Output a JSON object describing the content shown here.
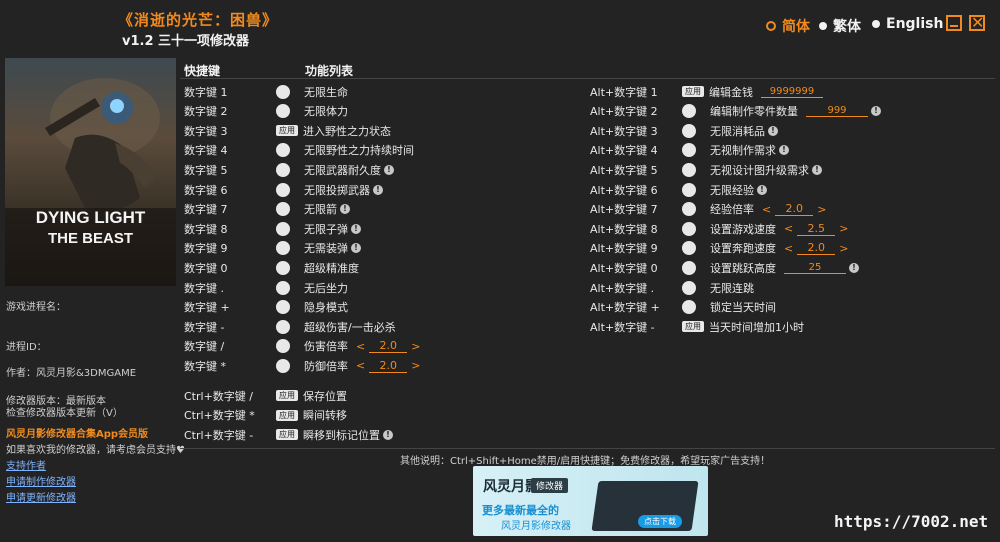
{
  "header": {
    "title": "《消逝的光芒：困兽》",
    "subtitle": "v1.2 三十一项修改器"
  },
  "languages": [
    {
      "label": "简体",
      "selected": true
    },
    {
      "label": "繁体",
      "selected": false
    },
    {
      "label": "English",
      "selected": false
    }
  ],
  "window_buttons": {
    "minimize_icon": "minimize-icon",
    "close_icon": "close-icon",
    "close_glyph": "✕"
  },
  "cover": {
    "line1": "DYING LIGHT",
    "line2": "THE BEAST"
  },
  "left_panel": {
    "process_name": "游戏进程名：",
    "process_id": "进程ID：",
    "author": "作者：风灵月影&3DMGAME",
    "version": "修改器版本：最新版本",
    "check_update": "检查修改器版本更新（V）",
    "promo": "风灵月影修改器合集App会员版",
    "support": "如果喜欢我的修改器，请考虑会员支持♥",
    "links": [
      "支持作者",
      "申请制作修改器",
      "申请更新修改器"
    ]
  },
  "columns": {
    "hotkey": "快捷键",
    "function_list": "功能列表"
  },
  "left_rows": [
    {
      "key": "数字键 1",
      "ctrl": "toggle",
      "label": "无限生命"
    },
    {
      "key": "数字键 2",
      "ctrl": "toggle",
      "label": "无限体力"
    },
    {
      "key": "数字键 3",
      "ctrl": "apply",
      "label": "进入野性之力状态"
    },
    {
      "key": "数字键 4",
      "ctrl": "toggle",
      "label": "无限野性之力持续时间"
    },
    {
      "key": "数字键 5",
      "ctrl": "toggle",
      "label": "无限武器耐久度",
      "info": true
    },
    {
      "key": "数字键 6",
      "ctrl": "toggle",
      "label": "无限投掷武器",
      "info": true
    },
    {
      "key": "数字键 7",
      "ctrl": "toggle",
      "label": "无限箭",
      "info": true
    },
    {
      "key": "数字键 8",
      "ctrl": "toggle",
      "label": "无限子弹",
      "info": true
    },
    {
      "key": "数字键 9",
      "ctrl": "toggle",
      "label": "无需装弹",
      "info": true
    },
    {
      "key": "数字键 0",
      "ctrl": "toggle",
      "label": "超级精准度"
    },
    {
      "key": "数字键 .",
      "ctrl": "toggle",
      "label": "无后坐力"
    },
    {
      "key": "数字键 +",
      "ctrl": "toggle",
      "label": "隐身模式"
    },
    {
      "key": "数字键 -",
      "ctrl": "toggle",
      "label": "超级伤害/一击必杀"
    },
    {
      "key": "数字键 /",
      "ctrl": "toggle",
      "label": "伤害倍率",
      "spin": "2.0"
    },
    {
      "key": "数字键 *",
      "ctrl": "toggle",
      "label": "防御倍率",
      "spin": "2.0"
    }
  ],
  "ctrl_rows": [
    {
      "key": "Ctrl+数字键 /",
      "ctrl": "apply",
      "label": "保存位置"
    },
    {
      "key": "Ctrl+数字键 *",
      "ctrl": "apply",
      "label": "瞬间转移"
    },
    {
      "key": "Ctrl+数字键 -",
      "ctrl": "apply",
      "label": "瞬移到标记位置",
      "info": true
    }
  ],
  "right_rows": [
    {
      "key": "Alt+数字键 1",
      "ctrl": "apply",
      "label": "编辑金钱",
      "field": "9999999"
    },
    {
      "key": "Alt+数字键 2",
      "ctrl": "toggle",
      "label": "编辑制作零件数量",
      "field": "999",
      "info": true
    },
    {
      "key": "Alt+数字键 3",
      "ctrl": "toggle",
      "label": "无限消耗品",
      "info": true
    },
    {
      "key": "Alt+数字键 4",
      "ctrl": "toggle",
      "label": "无视制作需求",
      "info": true
    },
    {
      "key": "Alt+数字键 5",
      "ctrl": "toggle",
      "label": "无视设计图升级需求",
      "info": true
    },
    {
      "key": "Alt+数字键 6",
      "ctrl": "toggle",
      "label": "无限经验",
      "info": true
    },
    {
      "key": "Alt+数字键 7",
      "ctrl": "toggle",
      "label": "经验倍率",
      "spin": "2.0"
    },
    {
      "key": "Alt+数字键 8",
      "ctrl": "toggle",
      "label": "设置游戏速度",
      "spin": "2.5"
    },
    {
      "key": "Alt+数字键 9",
      "ctrl": "toggle",
      "label": "设置奔跑速度",
      "spin": "2.0"
    },
    {
      "key": "Alt+数字键 0",
      "ctrl": "toggle",
      "label": "设置跳跃高度",
      "field": "25",
      "info": true
    },
    {
      "key": "Alt+数字键 .",
      "ctrl": "toggle",
      "label": "无限连跳"
    },
    {
      "key": "Alt+数字键 +",
      "ctrl": "toggle",
      "label": "锁定当天时间"
    },
    {
      "key": "Alt+数字键 -",
      "ctrl": "apply",
      "label": "当天时间增加1小时"
    }
  ],
  "apply_label": "应用",
  "info_glyph": "!",
  "spin_left": "<",
  "spin_right": ">",
  "footer_note": "其他说明：Ctrl+Shift+Home禁用/启用快捷键；免费修改器，希望玩家广告支持！",
  "ad": {
    "logo": "风灵月影",
    "tag": "修改器",
    "line1": "更多最新最全的",
    "line2": "风灵月影修改器",
    "button": "点击下载"
  },
  "watermark": "https://7002.net"
}
